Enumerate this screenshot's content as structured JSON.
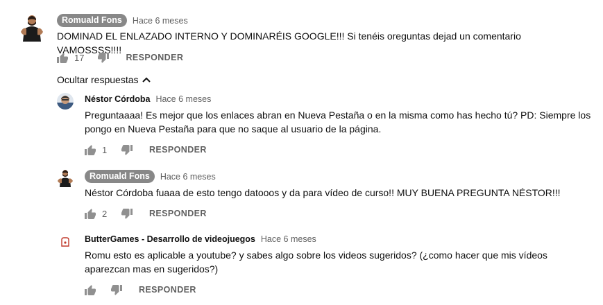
{
  "comments": [
    {
      "author": "Romuald Fons",
      "time": "Hace 6 meses",
      "text": "DOMINAD EL ENLAZADO INTERNO Y DOMINARÉIS GOOGLE!!! Si tenéis oreguntas dejad un comentario VAMOSSSS!!!!",
      "likes": "17",
      "reply": "RESPONDER"
    }
  ],
  "replies_toggle": "Ocultar respuestas",
  "replies": [
    {
      "author": "Néstor Córdoba",
      "time": "Hace 6 meses",
      "text": "Preguntaaaa! Es mejor que los enlaces abran en Nueva Pestaña o en la misma como has hecho tú? PD: Siempre los pongo en Nueva Pestaña para que no saque al usuario de la página.",
      "likes": "1",
      "reply": "RESPONDER"
    },
    {
      "author": "Romuald Fons",
      "time": "Hace 6 meses",
      "text": "Néstor Córdoba fuaaa de esto tengo datooos y da para vídeo de curso!! MUY BUENA PREGUNTA NÉSTOR!!!",
      "likes": "2",
      "reply": "RESPONDER"
    },
    {
      "author": "ButterGames - Desarrollo de videojuegos",
      "time": "Hace 6 meses",
      "text": "Romu esto es aplicable a youtube? y  sabes algo sobre los videos sugeridos? (¿como hacer que mis vídeos aparezcan mas en sugeridos?)",
      "likes": "",
      "reply": "RESPONDER"
    }
  ],
  "icons": {
    "like": "thumb-up-icon",
    "dislike": "thumb-down-icon",
    "toggle": "chevron-up-icon"
  },
  "colors": {
    "author_chip_bg": "#888888",
    "secondary_text": "#606060",
    "icon": "#909090"
  }
}
